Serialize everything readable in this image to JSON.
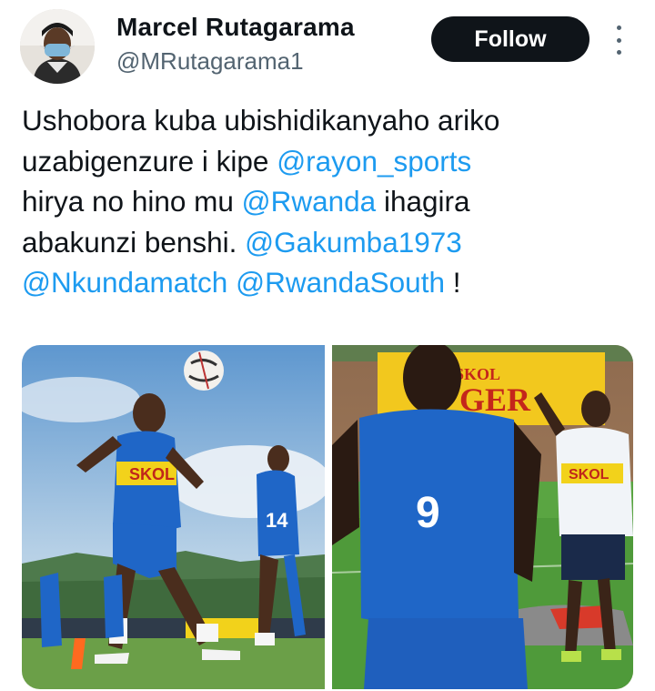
{
  "author": {
    "name": "Marcel Rutagarama",
    "handle": "@MRutagarama1"
  },
  "actions": {
    "follow_label": "Follow",
    "more_icon": "more-vertical-icon"
  },
  "tweet": {
    "lines": [
      [
        {
          "text": "Ushobora kuba ubishidikanyaho ariko"
        }
      ],
      [
        {
          "text": "uzabigenzure i kipe "
        },
        {
          "text": "@rayon_sports",
          "mention": true
        }
      ],
      [
        {
          "text": "hirya no hino mu "
        },
        {
          "text": "@Rwanda",
          "mention": true
        },
        {
          "text": " ihagira"
        }
      ],
      [
        {
          "text": "abakunzi benshi.  "
        },
        {
          "text": "@Gakumba1973",
          "mention": true
        }
      ],
      [
        {
          "text": "@Nkundamatch",
          "mention": true
        },
        {
          "text": "   "
        },
        {
          "text": "@RwandaSouth",
          "mention": true
        },
        {
          "text": " !"
        }
      ]
    ]
  },
  "media": {
    "left_photo": {
      "jersey_text": "SKOL",
      "number": "14"
    },
    "right_photo": {
      "banner_text": "SKOL",
      "banner_text2": "GER",
      "jersey_text": "SKOL",
      "number": "9"
    }
  },
  "colors": {
    "text": "#0f1419",
    "secondary": "#536471",
    "mention": "#1d9bf0",
    "button_bg": "#0f1419",
    "jersey_blue": "#1f66c7",
    "sponsor_yellow": "#f2d21b"
  }
}
